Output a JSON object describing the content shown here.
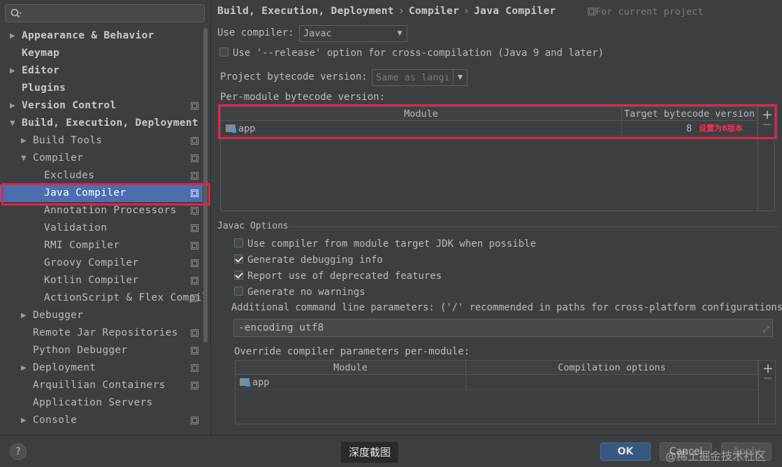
{
  "sidebar": {
    "search": {
      "placeholder": ""
    },
    "items": [
      {
        "label": "Appearance & Behavior",
        "level": 0,
        "arrow": "right",
        "bold": true,
        "project_icon": false
      },
      {
        "label": "Keymap",
        "level": 0,
        "arrow": "none",
        "bold": true,
        "project_icon": false
      },
      {
        "label": "Editor",
        "level": 0,
        "arrow": "right",
        "bold": true,
        "project_icon": false
      },
      {
        "label": "Plugins",
        "level": 0,
        "arrow": "none",
        "bold": true,
        "project_icon": false
      },
      {
        "label": "Version Control",
        "level": 0,
        "arrow": "right",
        "bold": true,
        "project_icon": true
      },
      {
        "label": "Build, Execution, Deployment",
        "level": 0,
        "arrow": "down",
        "bold": true,
        "project_icon": false
      },
      {
        "label": "Build Tools",
        "level": 1,
        "arrow": "right",
        "bold": false,
        "project_icon": true
      },
      {
        "label": "Compiler",
        "level": 1,
        "arrow": "down",
        "bold": false,
        "project_icon": true
      },
      {
        "label": "Excludes",
        "level": 2,
        "arrow": "none",
        "bold": false,
        "project_icon": true
      },
      {
        "label": "Java Compiler",
        "level": 2,
        "arrow": "none",
        "bold": false,
        "project_icon": true,
        "selected": true
      },
      {
        "label": "Annotation Processors",
        "level": 2,
        "arrow": "none",
        "bold": false,
        "project_icon": true
      },
      {
        "label": "Validation",
        "level": 2,
        "arrow": "none",
        "bold": false,
        "project_icon": true
      },
      {
        "label": "RMI Compiler",
        "level": 2,
        "arrow": "none",
        "bold": false,
        "project_icon": true
      },
      {
        "label": "Groovy Compiler",
        "level": 2,
        "arrow": "none",
        "bold": false,
        "project_icon": true
      },
      {
        "label": "Kotlin Compiler",
        "level": 2,
        "arrow": "none",
        "bold": false,
        "project_icon": true
      },
      {
        "label": "ActionScript & Flex Compil",
        "level": 2,
        "arrow": "none",
        "bold": false,
        "project_icon": true
      },
      {
        "label": "Debugger",
        "level": 1,
        "arrow": "right",
        "bold": false,
        "project_icon": false
      },
      {
        "label": "Remote Jar Repositories",
        "level": 1,
        "arrow": "none",
        "bold": false,
        "project_icon": true
      },
      {
        "label": "Python Debugger",
        "level": 1,
        "arrow": "none",
        "bold": false,
        "project_icon": true
      },
      {
        "label": "Deployment",
        "level": 1,
        "arrow": "right",
        "bold": false,
        "project_icon": true
      },
      {
        "label": "Arquillian Containers",
        "level": 1,
        "arrow": "none",
        "bold": false,
        "project_icon": true
      },
      {
        "label": "Application Servers",
        "level": 1,
        "arrow": "none",
        "bold": false,
        "project_icon": false
      },
      {
        "label": "Console",
        "level": 1,
        "arrow": "right",
        "bold": false,
        "project_icon": true
      }
    ]
  },
  "breadcrumb": {
    "part1": "Build, Execution, Deployment",
    "part2": "Compiler",
    "part3": "Java Compiler",
    "sep": "›"
  },
  "for_project": "For current project",
  "use_compiler": {
    "label": "Use compiler:",
    "value": "Javac"
  },
  "release_option": {
    "label": "Use '--release' option for cross-compilation (Java 9 and later)",
    "checked": false
  },
  "project_bytecode": {
    "label": "Project bytecode version:",
    "value": "Same as langı"
  },
  "per_module": {
    "label": "Per-module bytecode version:",
    "columns": [
      "Module",
      "Target bytecode version"
    ],
    "rows": [
      {
        "module": "app",
        "target": "8"
      }
    ],
    "annotation": "设置为8版本"
  },
  "javac_options": {
    "title": "Javac Options",
    "checkboxes": [
      {
        "label": "Use compiler from module target JDK when possible",
        "checked": false
      },
      {
        "label": "Generate debugging info",
        "checked": true
      },
      {
        "label": "Report use of deprecated features",
        "checked": true
      },
      {
        "label": "Generate no warnings",
        "checked": false
      }
    ],
    "params_label": "Additional command line parameters:  ('/' recommended in paths for cross-platform configurations)",
    "params_value": "-encoding utf8",
    "override_label": "Override compiler parameters per-module:",
    "override_columns": [
      "Module",
      "Compilation options"
    ],
    "override_rows": [
      {
        "module": "app",
        "options": ""
      }
    ]
  },
  "footer": {
    "help": "?",
    "ok": "OK",
    "cancel": "Cancel",
    "apply": "Apply",
    "screenshot_label": "深度截图",
    "watermark": "@稀土掘金技术社区"
  },
  "colors": {
    "accent_selection": "#4b6eaf",
    "annotation_red": "#e0254a",
    "background": "#3c3f41"
  }
}
